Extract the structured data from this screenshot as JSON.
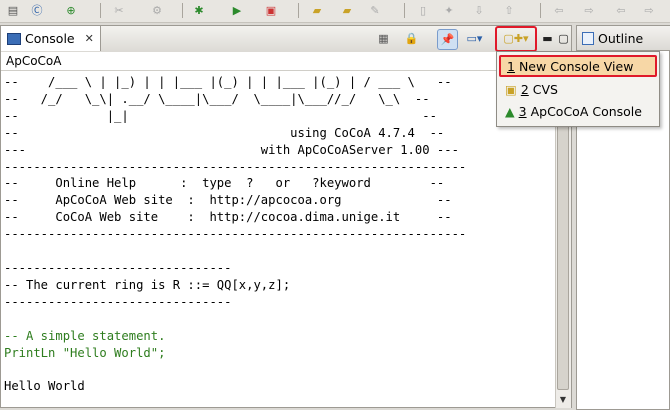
{
  "console_tab": {
    "title": "Console"
  },
  "outline_tab": {
    "title": "Outline"
  },
  "console_name": "ApCoCoA",
  "console_lines": [
    "--    /___ \\ | |_) | | |___ |(_) | | |___ |(_) | / ___ \\   --",
    "--   /_/   \\_\\| .__/ \\____|\\___/  \\____|\\___//_/   \\_\\  --",
    "--            |_|                                        --",
    "--                                     using CoCoA 4.7.4  --",
    "---                                with ApCoCoAServer 1.00 ---",
    "---------------------------------------------------------------",
    "--     Online Help      :  type  ?   or   ?keyword        --",
    "--     ApCoCoA Web site  :  http://apcocoa.org             --",
    "--     CoCoA Web site    :  http://cocoa.dima.unige.it     --",
    "---------------------------------------------------------------",
    "",
    "-------------------------------",
    "-- The current ring is R ::= QQ[x,y,z];",
    "-------------------------------",
    "",
    "-- A simple statement.",
    "PrintLn \"Hello World\";",
    "",
    "Hello World"
  ],
  "menu": {
    "items": [
      {
        "num": "1",
        "label": "New Console View"
      },
      {
        "num": "2",
        "label": "CVS"
      },
      {
        "num": "3",
        "label": "ApCoCoA Console"
      }
    ]
  },
  "icons": {
    "pin": "pin-icon",
    "display": "display-console-icon",
    "open_console": "open-console-icon"
  },
  "colors": {
    "highlight": "#e0192a",
    "comment": "#2e7d1e",
    "selection": "#f7d7a6"
  }
}
